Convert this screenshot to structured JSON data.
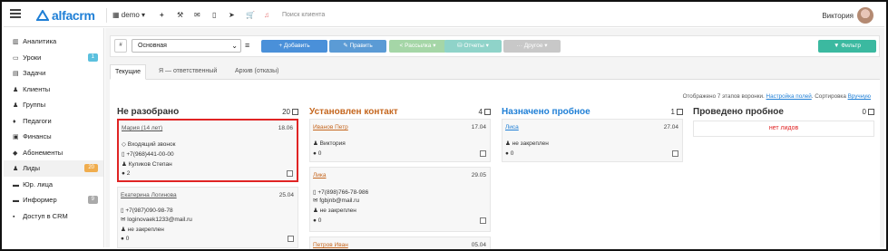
{
  "topbar": {
    "logo_text": "alfacrm",
    "account": "demo",
    "search_placeholder": "Поиск клиента",
    "user_name": "Виктория"
  },
  "sidebar": {
    "items": [
      {
        "icon": "chart-icon",
        "label": "Аналитика"
      },
      {
        "icon": "calendar-icon",
        "label": "Уроки",
        "badge": "1",
        "badge_color": "#5bc0de"
      },
      {
        "icon": "list-icon",
        "label": "Задачи"
      },
      {
        "icon": "user-icon",
        "label": "Клиенты"
      },
      {
        "icon": "users-icon",
        "label": "Группы"
      },
      {
        "icon": "graduation-icon",
        "label": "Педагоги"
      },
      {
        "icon": "money-icon",
        "label": "Финансы"
      },
      {
        "icon": "tag-icon",
        "label": "Абонементы"
      },
      {
        "icon": "user-plus-icon",
        "label": "Лиды",
        "badge": "20",
        "badge_color": "#f0ad4e",
        "active": true
      },
      {
        "icon": "building-icon",
        "label": "Юр. лица"
      },
      {
        "icon": "inbox-icon",
        "label": "Информер",
        "badge": "9",
        "badge_color": "#aaaaaa"
      },
      {
        "icon": "lock-icon",
        "label": "Доступ в CRM"
      }
    ]
  },
  "toolbar": {
    "filter_prefix": "#",
    "selected_view": "Основная",
    "add_label": "+ Добавить",
    "edit_label": "✎ Править",
    "mailing_label": "< Рассылка ▾",
    "reports_label": "⛁ Отчеты ▾",
    "other_label": "··· Другое ▾",
    "filter_label": "▼ Фильтр",
    "colors": {
      "add": "#4a90d9",
      "edit": "#5b9bd5",
      "mailing": "#a5d6a7",
      "reports": "#8fd3c9",
      "other": "#c8c8c8",
      "filter": "#3bb9a0"
    }
  },
  "tabs": [
    "Текущие",
    "Я — ответственный",
    "Архив (отказы)"
  ],
  "funnel_info": {
    "text": "Отображено 7 этапов воронки. ",
    "settings_link": "Настройка полей",
    "sort_text": ". Сортировка ",
    "sort_link": "Вручную"
  },
  "columns": [
    {
      "title": "Не разобрано",
      "count": "20",
      "color": "#333333",
      "cards": [
        {
          "name": "Мария (14 лет)",
          "date": "18.06",
          "lines": [
            "◇ Входящий звонок",
            "▯ +7(968)441-00-00",
            "♟ Куликов Степан",
            "● 2"
          ]
        },
        {
          "name": "Екатерина Логинова",
          "date": "25.04",
          "lines": [
            "▯ +7(987)090-98-78",
            "✉ loginovaek1233@mail.ru",
            "♟ не закреплен",
            "● 0"
          ]
        }
      ]
    },
    {
      "title": "Установлен контакт",
      "count": "4",
      "color": "#c5661e",
      "cards": [
        {
          "name": "Иванов Петр",
          "date": "17.04",
          "lines": [
            "♟ Виктория",
            "● 0"
          ]
        },
        {
          "name": "Лика",
          "date": "29.05",
          "lines": [
            "▯ +7(898)766-78-986",
            "✉ fgbjnb@mail.ru",
            "♟ не закреплен",
            "● 0"
          ]
        },
        {
          "name": "Петров Иван",
          "date": "05.04",
          "lines": []
        }
      ]
    },
    {
      "title": "Назначено пробное",
      "count": "1",
      "color": "#1f7fd6",
      "cards": [
        {
          "name": "Лиса",
          "date": "27.04",
          "lines": [
            "♟ не закреплен",
            "● 0"
          ]
        }
      ]
    },
    {
      "title": "Проведено пробное",
      "count": "0",
      "color": "#333333",
      "empty_text": "нет лидов"
    }
  ]
}
